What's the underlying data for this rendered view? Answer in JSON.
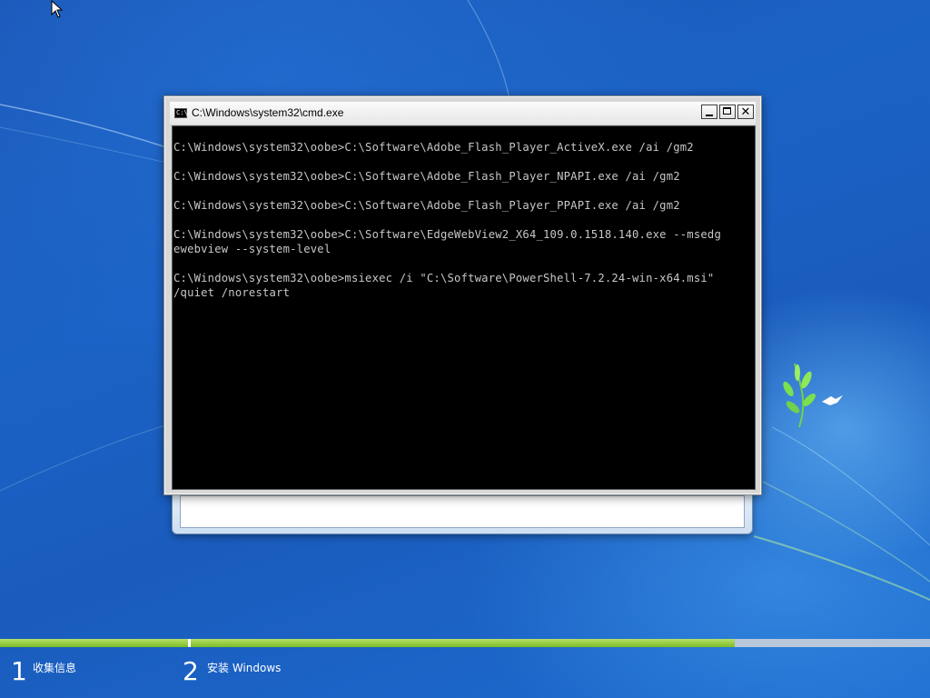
{
  "window": {
    "title": "C:\\Windows\\system32\\cmd.exe",
    "icon": "cmd-icon",
    "icon_text": "C:\\"
  },
  "controls": {
    "minimize": "minimize-icon",
    "maximize": "maximize-icon",
    "close": "close-icon",
    "close_glyph": "✕"
  },
  "console": {
    "lines": [
      "C:\\Windows\\system32\\oobe>C:\\Software\\Adobe_Flash_Player_ActiveX.exe /ai /gm2",
      "",
      "C:\\Windows\\system32\\oobe>C:\\Software\\Adobe_Flash_Player_NPAPI.exe /ai /gm2",
      "",
      "C:\\Windows\\system32\\oobe>C:\\Software\\Adobe_Flash_Player_PPAPI.exe /ai /gm2",
      "",
      "C:\\Windows\\system32\\oobe>C:\\Software\\EdgeWebView2_X64_109.0.1518.140.exe --msedg",
      "ewebview --system-level",
      "",
      "C:\\Windows\\system32\\oobe>msiexec /i \"C:\\Software\\PowerShell-7.2.24-win-x64.msi\"",
      "/quiet /norestart"
    ]
  },
  "setup": {
    "progress_fraction": 0.79,
    "steps": [
      {
        "number": "1",
        "label": "收集信息"
      },
      {
        "number": "2",
        "label": "安装 Windows"
      }
    ]
  },
  "colors": {
    "console_text": "#c7c7c7",
    "progress_green": "#8cc63f",
    "desktop_blue": "#1b62c5"
  }
}
